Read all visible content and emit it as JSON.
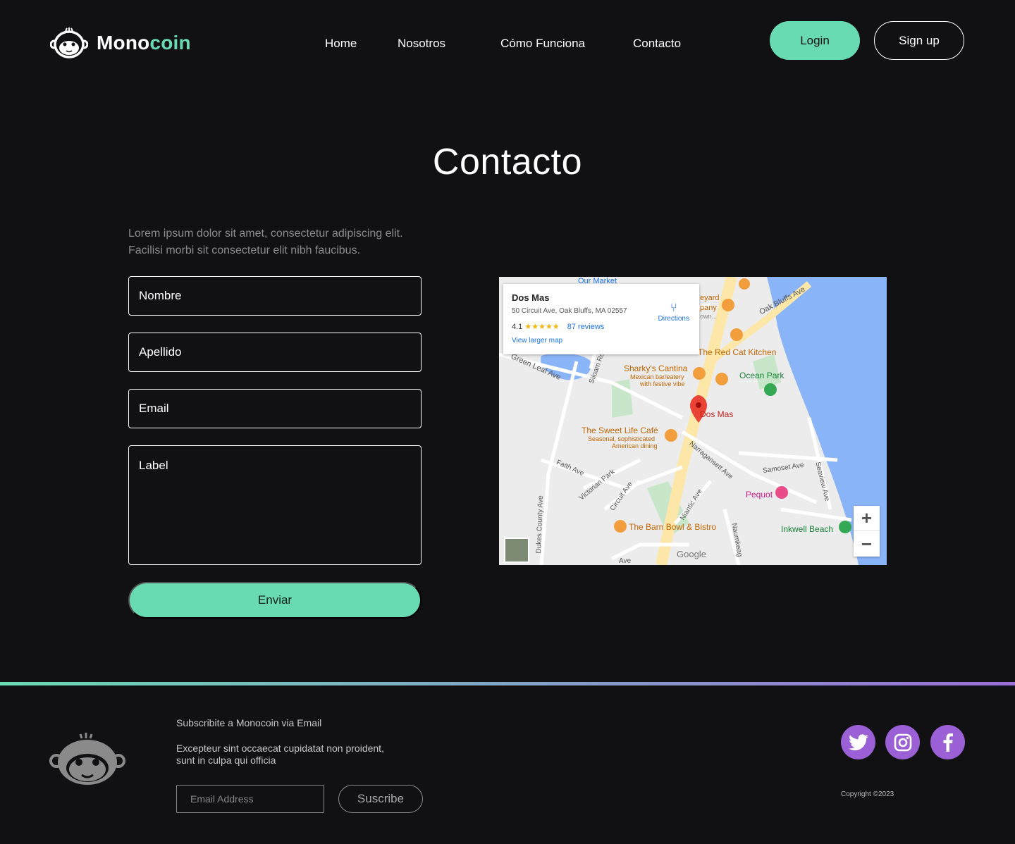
{
  "brand": {
    "name_part1": "Mono",
    "name_part2": "coin"
  },
  "nav": {
    "home": "Home",
    "about": "Nosotros",
    "how": "Cómo Funciona",
    "contact": "Contacto"
  },
  "auth": {
    "login": "Login",
    "signup": "Sign up"
  },
  "page": {
    "title": "Contacto",
    "lead": "Lorem ipsum dolor sit amet, consectetur adipiscing elit. Facilisi morbi sit consectetur elit nibh faucibus."
  },
  "form": {
    "first_name": "Nombre",
    "last_name": "Apellido",
    "email": "Email",
    "message": "Label",
    "submit": "Enviar"
  },
  "map": {
    "place_name": "Dos Mas",
    "address": "50 Circuit Ave, Oak Bluffs, MA 02557",
    "rating": "4.1",
    "stars": "★★★★★",
    "reviews": "87 reviews",
    "larger_map": "View larger map",
    "directions": "Directions",
    "labels": {
      "our_market": "Our Market",
      "vineyard": "eyard",
      "company": "pany",
      "town": "own...",
      "oak_bluffs_ave": "Oak Bluffs Ave",
      "red_cat": "The Red Cat Kitchen",
      "green_leaf": "Green Leaf Ave",
      "siloam": "Siloam Rd",
      "sharkys": "Sharky's Cantina",
      "sharkys_sub1": "Mexican bar/eatery",
      "sharkys_sub2": "with festive vibe",
      "ocean_park": "Ocean Park",
      "dos_mas_pin": "Dos Mas",
      "sweet_life": "The Sweet Life Café",
      "sweet_sub1": "Seasonal, sophisticated",
      "sweet_sub2": "American dining",
      "faith_ave": "Faith Ave",
      "narragansett": "Narragansett Ave",
      "samoset": "Samoset Ave",
      "seaview": "Seaview Ave",
      "victorian_park": "Victorian Park",
      "circuit_ave": "Circuit Ave",
      "pequot": "Pequot",
      "niantic": "Niantic Ave",
      "dukes_county": "Dukes County Ave",
      "barn_bowl": "The Barn Bowl & Bistro",
      "naumkeag": "Naumkeag",
      "inkwell": "Inkwell Beach",
      "google": "Google",
      "ave_bottom": "Ave"
    },
    "zoom_in": "+",
    "zoom_out": "−"
  },
  "footer": {
    "subscribe_title": "Subscribite a Monocoin via Email",
    "subscribe_text": "Excepteur sint occaecat cupidatat non proident, sunt in culpa qui officia",
    "email_placeholder": "Email Address",
    "subscribe_button": "Suscribe",
    "copyright": "Copyright ©2023",
    "social": [
      "twitter-icon",
      "instagram-icon",
      "facebook-icon"
    ]
  },
  "colors": {
    "accent": "#69dbb3",
    "purple": "#9b5fd6",
    "background": "#111114"
  }
}
